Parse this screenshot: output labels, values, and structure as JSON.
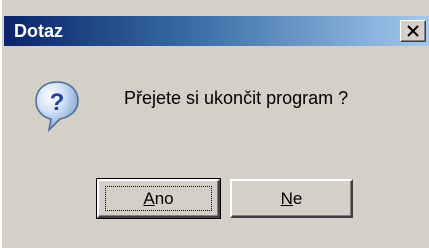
{
  "window": {
    "title": "Dotaz",
    "close_label": "×"
  },
  "dialog": {
    "icon": "question-icon",
    "message": "Přejete si ukončit program ?"
  },
  "buttons": {
    "yes": {
      "mnemonic": "A",
      "rest": "no"
    },
    "no": {
      "mnemonic": "N",
      "rest": "e"
    }
  },
  "colors": {
    "titlebar_start": "#0a246a",
    "titlebar_end": "#a6caf0",
    "face": "#d4d0c8"
  }
}
